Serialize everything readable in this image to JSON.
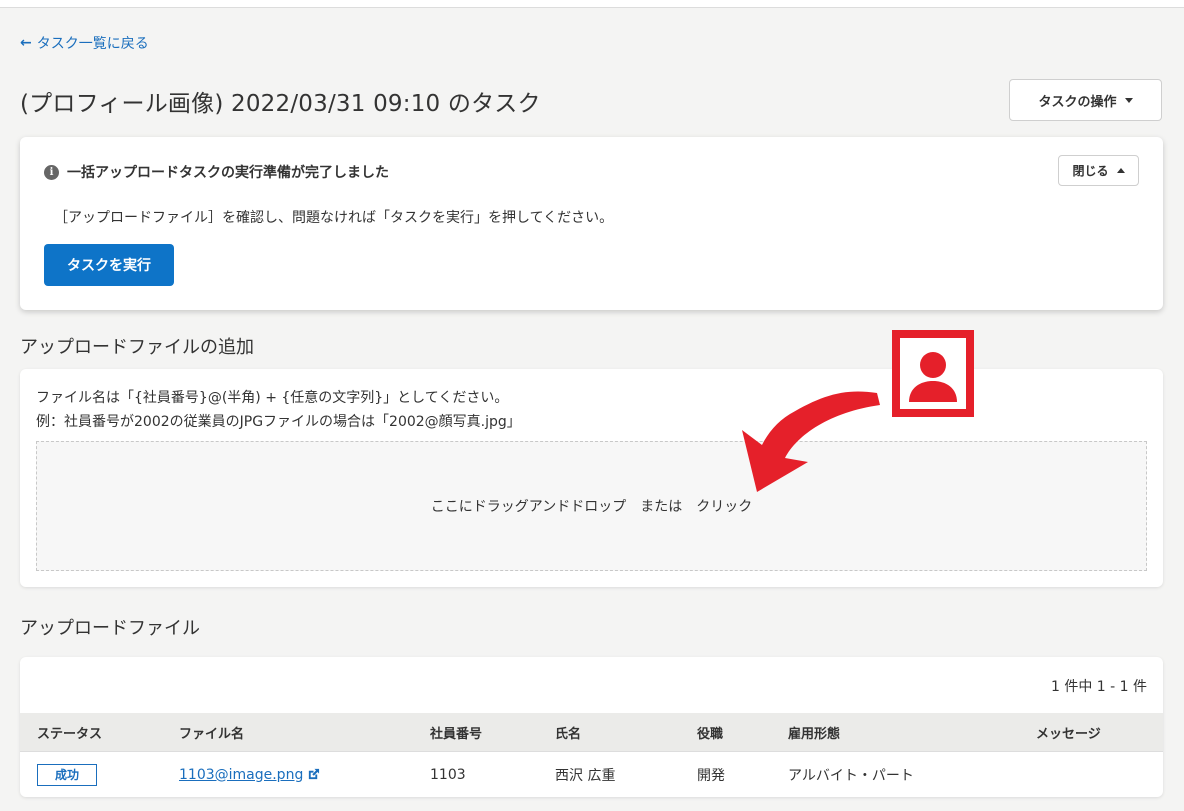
{
  "nav": {
    "back_label": "タスク一覧に戻る"
  },
  "page": {
    "title": "(プロフィール画像) 2022/03/31 09:10 のタスク",
    "task_ops_label": "タスクの操作"
  },
  "notice": {
    "heading": "一括アップロードタスクの実行準備が完了しました",
    "close_label": "閉じる",
    "body": "［アップロードファイル］を確認し、問題なければ「タスクを実行」を押してください。",
    "run_label": "タスクを実行"
  },
  "upload": {
    "section_title": "アップロードファイルの追加",
    "hint_line1": "ファイル名は「{社員番号}@(半角) + {任意の文字列}」としてください。",
    "hint_line2": "例：社員番号が2002の従業員のJPGファイルの場合は「2002@顔写真.jpg」",
    "dropzone_text": "ここにドラッグアンドドロップ　または　クリック"
  },
  "files": {
    "section_title": "アップロードファイル",
    "count_text": "1 件中 1 - 1 件",
    "headers": [
      "ステータス",
      "ファイル名",
      "社員番号",
      "氏名",
      "役職",
      "雇用形態",
      "メッセージ"
    ],
    "rows": [
      {
        "status": "成功",
        "file_name": "1103@image.png",
        "employee_no": "1103",
        "name": "西沢 広重",
        "position": "開発",
        "employment": "アルバイト・パート",
        "message": ""
      }
    ]
  },
  "colors": {
    "accent": "#0e74c8",
    "link": "#1a6ebd",
    "annotation_red": "#e5202a"
  },
  "icons": [
    "arrow-left-icon",
    "chevron-down-icon",
    "info-icon",
    "chevron-up-icon",
    "external-link-icon",
    "person-silhouette-icon",
    "curved-arrow-icon"
  ]
}
